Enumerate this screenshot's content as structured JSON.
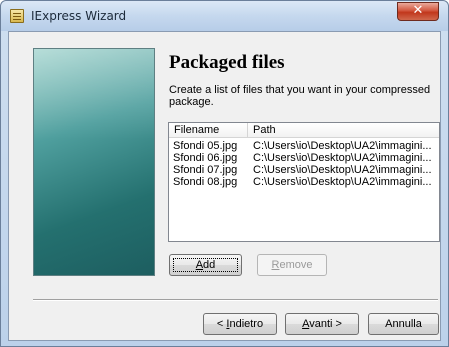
{
  "window": {
    "title": "IExpress Wizard",
    "close_symbol": "✕"
  },
  "page": {
    "title": "Packaged files",
    "description": "Create a list of files that you want in your compressed package."
  },
  "file_list": {
    "columns": [
      "Filename",
      "Path"
    ],
    "rows": [
      {
        "filename": "Sfondi 05.jpg",
        "path": "C:\\Users\\io\\Desktop\\UA2\\immagini..."
      },
      {
        "filename": "Sfondi 06.jpg",
        "path": "C:\\Users\\io\\Desktop\\UA2\\immagini..."
      },
      {
        "filename": "Sfondi 07.jpg",
        "path": "C:\\Users\\io\\Desktop\\UA2\\immagini..."
      },
      {
        "filename": "Sfondi 08.jpg",
        "path": "C:\\Users\\io\\Desktop\\UA2\\immagini..."
      }
    ]
  },
  "buttons": {
    "add": {
      "mnemonic": "A",
      "rest": "dd"
    },
    "remove": {
      "mnemonic": "R",
      "rest": "emove"
    },
    "back": {
      "prefix": "< ",
      "mnemonic": "I",
      "rest": "ndietro"
    },
    "next": {
      "mnemonic": "A",
      "rest": "vanti >"
    },
    "cancel": {
      "label": "Annulla"
    }
  }
}
